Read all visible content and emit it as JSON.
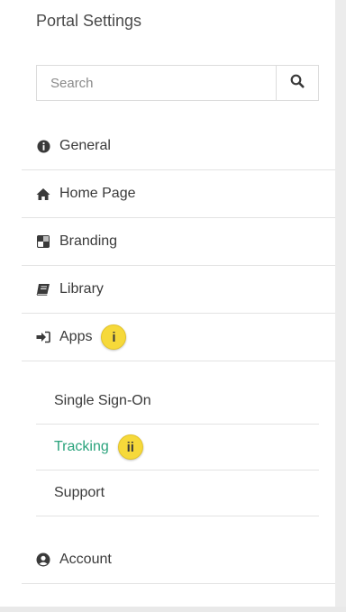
{
  "header": {
    "title": "Portal Settings"
  },
  "search": {
    "placeholder": "Search",
    "value": ""
  },
  "nav": {
    "items": [
      {
        "label": "General",
        "icon": "info-circle-icon"
      },
      {
        "label": "Home Page",
        "icon": "home-icon"
      },
      {
        "label": "Branding",
        "icon": "branding-icon"
      },
      {
        "label": "Library",
        "icon": "book-icon"
      },
      {
        "label": "Apps",
        "icon": "sign-in-icon",
        "badge": "i"
      }
    ],
    "account": {
      "label": "Account",
      "icon": "user-circle-icon"
    }
  },
  "apps_submenu": {
    "items": [
      {
        "label": "Single Sign-On",
        "active": false
      },
      {
        "label": "Tracking",
        "active": true,
        "badge": "ii"
      },
      {
        "label": "Support",
        "active": false
      }
    ]
  },
  "colors": {
    "active_link": "#2aa37c",
    "badge": "#f6d93a",
    "background": "#f3f3f3",
    "panel": "#ffffff"
  }
}
